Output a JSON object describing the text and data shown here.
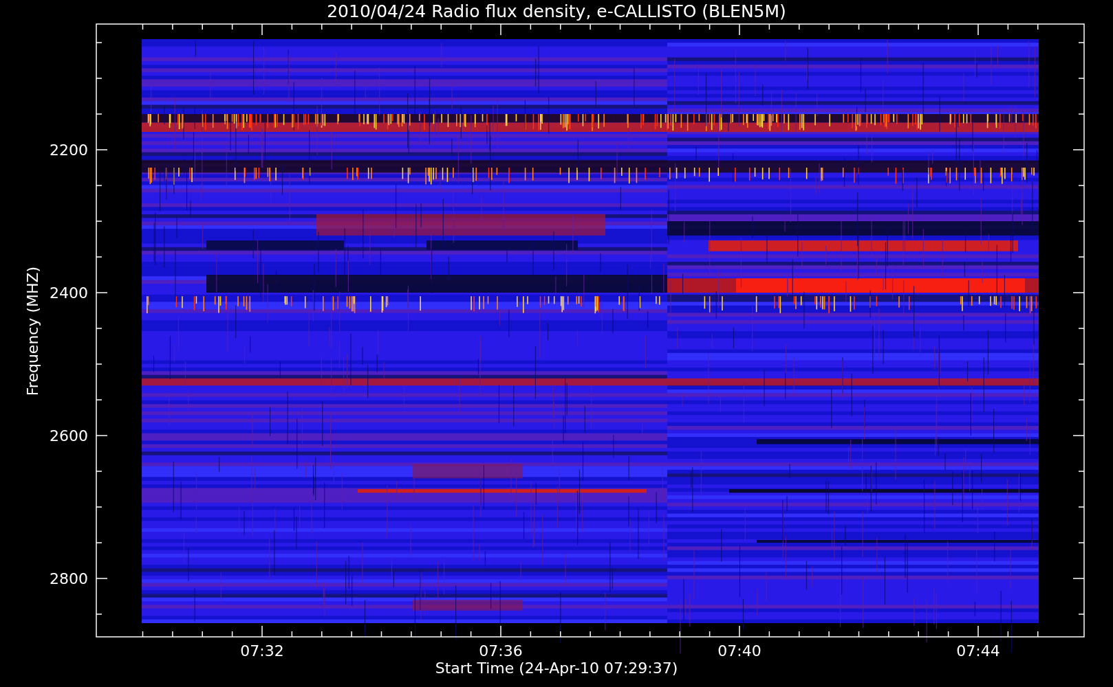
{
  "title": "2010/04/24  Radio flux density, e-CALLISTO (BLEN5M)",
  "y_axis": {
    "label": "Frequency (MHZ)",
    "tick_labels": [
      "2200",
      "2400",
      "2600",
      "2800"
    ]
  },
  "x_axis": {
    "label": "Start Time (24-Apr-10 07:29:37)",
    "tick_labels": [
      "07:32",
      "07:36",
      "07:40",
      "07:44"
    ]
  }
}
